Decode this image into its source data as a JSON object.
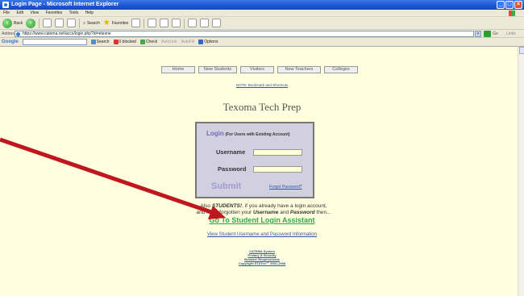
{
  "window": {
    "title": "Login Page - Microsoft Internet Explorer"
  },
  "menubar": {
    "items": [
      "File",
      "Edit",
      "View",
      "Favorites",
      "Tools",
      "Help"
    ]
  },
  "toolbar": {
    "back": "Back",
    "search": "Search",
    "favorites": "Favorites"
  },
  "address": {
    "label": "Address",
    "url": "https://www.catema.net/accs/login.php?id=etexne",
    "go": "Go",
    "links": "Links"
  },
  "googlebar": {
    "logo": "Google",
    "search": "Search",
    "blocked": "0 blocked",
    "check": "Check",
    "autolink": "AutoLink",
    "autofill": "AutoFill",
    "options": "Options"
  },
  "nav": [
    "Home",
    "New Students",
    "Visitors",
    "New Teachers",
    "Colleges"
  ],
  "note": "NOTE: Bookmark and Shortcuts",
  "site_title": "Texoma Tech Prep",
  "login": {
    "header_big": "Login",
    "header_small": "(For Users with Existing Account)",
    "username_label": "Username",
    "password_label": "Password",
    "submit": "Submit",
    "forgot": "Forgot Password?"
  },
  "students": {
    "line1_pre": "Also ",
    "line1_bold": "STUDENTS!",
    "line1_post": ", if you already have a login account,",
    "line2_pre": "and have forgotten your ",
    "line2_b1": "Username",
    "line2_mid": " and ",
    "line2_b2": "Password",
    "line2_post": " then..."
  },
  "assistant_link": "Go To Student Login Assistant",
  "view_info_link": "View Student Username and Password Information",
  "footer": [
    "CATEMA System",
    "Privacy & Security",
    "Browser Requirements",
    "Copyright STATco™ 2001-2008"
  ],
  "colors": {
    "page_bg": "#ffffdf",
    "accent_green": "#2ea84a",
    "login_box_bg": "#d2d0e0",
    "arrow": "#c0161e"
  }
}
